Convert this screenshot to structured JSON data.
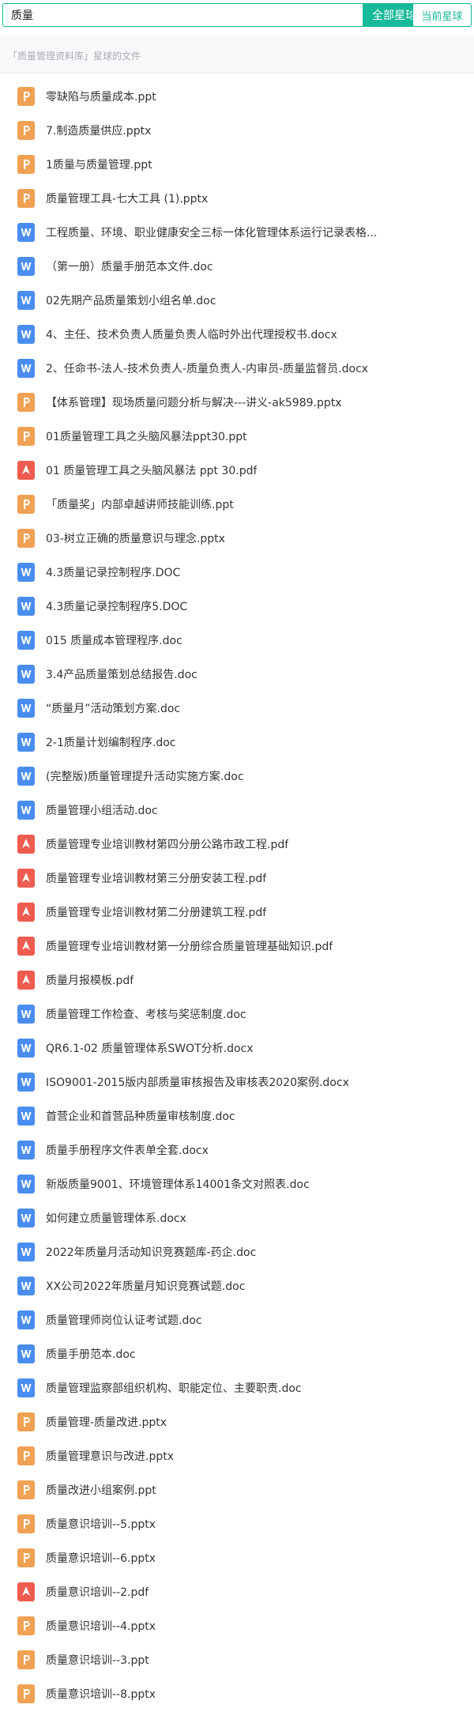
{
  "search": {
    "value": "质量",
    "placeholder": "",
    "all_button": "全部星球",
    "current_button": "当前星球"
  },
  "scope": {
    "text": "「质量管理资料库」星球的文件"
  },
  "colors": {
    "accent": "#16b998",
    "ppt": "#f0a153",
    "doc": "#4a8df0",
    "pdf": "#ef5b4f"
  },
  "files": [
    {
      "name": "零缺陷与质量成本.ppt",
      "type": "ppt"
    },
    {
      "name": "7.制造质量供应.pptx",
      "type": "ppt"
    },
    {
      "name": "1质量与质量管理.ppt",
      "type": "ppt"
    },
    {
      "name": "质量管理工具-七大工具 (1).pptx",
      "type": "ppt"
    },
    {
      "name": "工程质量、环境、职业健康安全三标一体化管理体系运行记录表格...",
      "type": "doc"
    },
    {
      "name": "（第一册）质量手册范本文件.doc",
      "type": "doc"
    },
    {
      "name": "02先期产品质量策划小组名单.doc",
      "type": "doc"
    },
    {
      "name": "4、主任、技术负责人质量负责人临时外出代理授权书.docx",
      "type": "doc"
    },
    {
      "name": "2、任命书-法人-技术负责人-质量负责人-内审员-质量监督员.docx",
      "type": "doc"
    },
    {
      "name": "【体系管理】现场质量问题分析与解决---讲义-ak5989.pptx",
      "type": "ppt"
    },
    {
      "name": "01质量管理工具之头脑风暴法ppt30.ppt",
      "type": "ppt"
    },
    {
      "name": "01 质量管理工具之头脑风暴法 ppt 30.pdf",
      "type": "pdf"
    },
    {
      "name": "「质量奖」内部卓越讲师技能训练.ppt",
      "type": "ppt"
    },
    {
      "name": "03-树立正确的质量意识与理念.pptx",
      "type": "ppt"
    },
    {
      "name": "4.3质量记录控制程序.DOC",
      "type": "doc"
    },
    {
      "name": "4.3质量记录控制程序5.DOC",
      "type": "doc"
    },
    {
      "name": "015 质量成本管理程序.doc",
      "type": "doc"
    },
    {
      "name": "3.4产品质量策划总结报告.doc",
      "type": "doc"
    },
    {
      "name": "“质量月”活动策划方案.doc",
      "type": "doc"
    },
    {
      "name": "2-1质量计划编制程序.doc",
      "type": "doc"
    },
    {
      "name": "(完整版)质量管理提升活动实施方案.doc",
      "type": "doc"
    },
    {
      "name": "质量管理小组活动.doc",
      "type": "doc"
    },
    {
      "name": "质量管理专业培训教材第四分册公路市政工程.pdf",
      "type": "pdf"
    },
    {
      "name": "质量管理专业培训教材第三分册安装工程.pdf",
      "type": "pdf"
    },
    {
      "name": "质量管理专业培训教材第二分册建筑工程.pdf",
      "type": "pdf"
    },
    {
      "name": "质量管理专业培训教材第一分册综合质量管理基础知识.pdf",
      "type": "pdf"
    },
    {
      "name": "质量月报模板.pdf",
      "type": "pdf"
    },
    {
      "name": "质量管理工作检查、考核与奖惩制度.doc",
      "type": "doc"
    },
    {
      "name": "QR6.1-02 质量管理体系SWOT分析.docx",
      "type": "doc"
    },
    {
      "name": "ISO9001-2015版内部质量审核报告及审核表2020案例.docx",
      "type": "doc"
    },
    {
      "name": "首营企业和首营品种质量审核制度.doc",
      "type": "doc"
    },
    {
      "name": "质量手册程序文件表单全套.docx",
      "type": "doc"
    },
    {
      "name": "新版质量9001、环境管理体系14001条文对照表.doc",
      "type": "doc"
    },
    {
      "name": "如何建立质量管理体系.docx",
      "type": "doc"
    },
    {
      "name": "2022年质量月活动知识竞赛题库-药企.doc",
      "type": "doc"
    },
    {
      "name": "XX公司2022年质量月知识竞赛试题.doc",
      "type": "doc"
    },
    {
      "name": "质量管理师岗位认证考试题.doc",
      "type": "doc"
    },
    {
      "name": "质量手册范本.doc",
      "type": "doc"
    },
    {
      "name": "质量管理监察部组织机构、职能定位、主要职责.doc",
      "type": "doc"
    },
    {
      "name": "质量管理-质量改进.pptx",
      "type": "ppt"
    },
    {
      "name": "质量管理意识与改进.pptx",
      "type": "ppt"
    },
    {
      "name": "质量改进小组案例.ppt",
      "type": "ppt"
    },
    {
      "name": "质量意识培训--5.pptx",
      "type": "ppt"
    },
    {
      "name": "质量意识培训--6.pptx",
      "type": "ppt"
    },
    {
      "name": "质量意识培训--2.pdf",
      "type": "pdf"
    },
    {
      "name": "质量意识培训--4.pptx",
      "type": "ppt"
    },
    {
      "name": "质量意识培训--3.ppt",
      "type": "ppt"
    },
    {
      "name": "质量意识培训--8.pptx",
      "type": "ppt"
    }
  ]
}
